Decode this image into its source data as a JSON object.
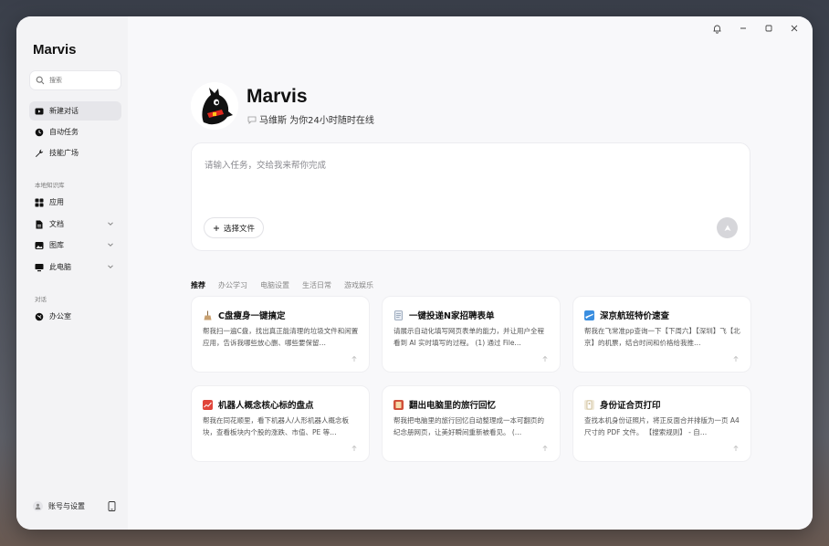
{
  "app": {
    "name": "Marvis"
  },
  "sidebar": {
    "search_placeholder": "搜索",
    "items": [
      {
        "label": "新建对话",
        "icon": "new-chat-icon"
      },
      {
        "label": "自动任务",
        "icon": "auto-task-icon"
      },
      {
        "label": "技能广场",
        "icon": "wrench-icon"
      }
    ],
    "knowledge_label": "本地知识库",
    "knowledge": [
      {
        "label": "应用",
        "icon": "grid-icon"
      },
      {
        "label": "文档",
        "icon": "document-icon"
      },
      {
        "label": "图库",
        "icon": "image-icon"
      },
      {
        "label": "此电脑",
        "icon": "monitor-icon"
      }
    ],
    "chat_label": "对话",
    "chats": [
      {
        "label": "办公室",
        "icon": "chat-icon"
      }
    ],
    "account_label": "账号与设置"
  },
  "hero": {
    "title": "Marvis",
    "subtitle": "马维斯 为你24小时随时在线"
  },
  "composer": {
    "placeholder": "请输入任务，交给我来帮你完成",
    "file_button": "选择文件"
  },
  "tabs": [
    "推荐",
    "办公学习",
    "电脑设置",
    "生活日常",
    "游戏娱乐"
  ],
  "cards": [
    {
      "title": "C盘瘦身一键搞定",
      "icon": "broom-icon",
      "color": "#c8a070",
      "desc": "帮我扫一遍C盘，找出真正能清理的垃圾文件和闲置应用，告诉我哪些放心删、哪些要保留…"
    },
    {
      "title": "一键投递N家招聘表单",
      "icon": "form-icon",
      "color": "#8a9ab0",
      "desc": "请展示自动化填写网页表单的能力，并让用户全程看到 AI 实时填写的过程。 (1) 通过 File…"
    },
    {
      "title": "深京航班特价速查",
      "icon": "flight-icon",
      "color": "#3a8ee0",
      "desc": "帮我在飞常准pp查询一下【下周六】【深圳】飞【北京】的机票，结合时间和价格给我推…"
    },
    {
      "title": "机器人概念核心标的盘点",
      "icon": "chart-icon",
      "color": "#e0453a",
      "desc": "帮我在同花顺里，看下机器人/人形机器人概念板块，查看板块内个股的涨跌、市值、PE 等…"
    },
    {
      "title": "翻出电脑里的旅行回忆",
      "icon": "album-icon",
      "color": "#d0503a",
      "desc": "帮我把电脑里的旅行回忆自动整理成一本可翻页的纪念册网页，让美好瞬间重新被看见。 (…"
    },
    {
      "title": "身份证合页打印",
      "icon": "id-card-icon",
      "color": "#c9b890",
      "desc": "查找本机身份证照片，将正反面合并排版为一页 A4 尺寸的 PDF 文件。 【搜索规则】 - 自…"
    }
  ]
}
